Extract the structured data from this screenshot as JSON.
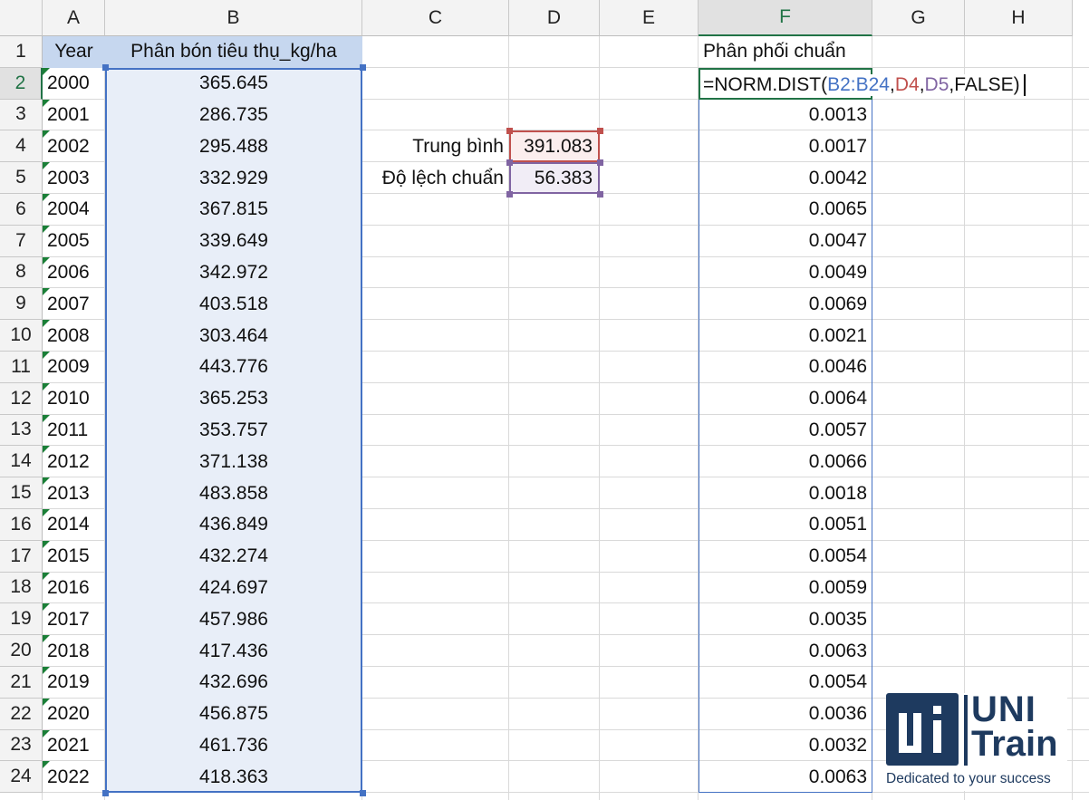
{
  "columns": [
    "A",
    "B",
    "C",
    "D",
    "E",
    "F",
    "G",
    "H"
  ],
  "active_cell": {
    "column": "F",
    "row": "2"
  },
  "header_cells": {
    "A1": "Year",
    "B1": "Phân bón tiêu thụ_kg/ha",
    "F1": "Phân phối chuẩn"
  },
  "rows": [
    {
      "n": "2",
      "year": "2000",
      "value": "365.645",
      "f": ""
    },
    {
      "n": "3",
      "year": "2001",
      "value": "286.735",
      "f": "0.0013"
    },
    {
      "n": "4",
      "year": "2002",
      "value": "295.488",
      "f": "0.0017"
    },
    {
      "n": "5",
      "year": "2003",
      "value": "332.929",
      "f": "0.0042"
    },
    {
      "n": "6",
      "year": "2004",
      "value": "367.815",
      "f": "0.0065"
    },
    {
      "n": "7",
      "year": "2005",
      "value": "339.649",
      "f": "0.0047"
    },
    {
      "n": "8",
      "year": "2006",
      "value": "342.972",
      "f": "0.0049"
    },
    {
      "n": "9",
      "year": "2007",
      "value": "403.518",
      "f": "0.0069"
    },
    {
      "n": "10",
      "year": "2008",
      "value": "303.464",
      "f": "0.0021"
    },
    {
      "n": "11",
      "year": "2009",
      "value": "443.776",
      "f": "0.0046"
    },
    {
      "n": "12",
      "year": "2010",
      "value": "365.253",
      "f": "0.0064"
    },
    {
      "n": "13",
      "year": "2011",
      "value": "353.757",
      "f": "0.0057"
    },
    {
      "n": "14",
      "year": "2012",
      "value": "371.138",
      "f": "0.0066"
    },
    {
      "n": "15",
      "year": "2013",
      "value": "483.858",
      "f": "0.0018"
    },
    {
      "n": "16",
      "year": "2014",
      "value": "436.849",
      "f": "0.0051"
    },
    {
      "n": "17",
      "year": "2015",
      "value": "432.274",
      "f": "0.0054"
    },
    {
      "n": "18",
      "year": "2016",
      "value": "424.697",
      "f": "0.0059"
    },
    {
      "n": "19",
      "year": "2017",
      "value": "457.986",
      "f": "0.0035"
    },
    {
      "n": "20",
      "year": "2018",
      "value": "417.436",
      "f": "0.0063"
    },
    {
      "n": "21",
      "year": "2019",
      "value": "432.696",
      "f": "0.0054"
    },
    {
      "n": "22",
      "year": "2020",
      "value": "456.875",
      "f": "0.0036"
    },
    {
      "n": "23",
      "year": "2021",
      "value": "461.736",
      "f": "0.0032"
    },
    {
      "n": "24",
      "year": "2022",
      "value": "418.363",
      "f": "0.0063"
    }
  ],
  "stats": {
    "mean_label": "Trung bình",
    "mean_value": "391.083",
    "sd_label": "Độ lệch chuẩn",
    "sd_value": "56.383"
  },
  "formula": {
    "prefix": "=NORM.DIST(",
    "ref_range": "B2:B24",
    "sep1": ",",
    "ref_mean": "D4",
    "sep2": ",",
    "ref_sd": "D5",
    "suffix": ",FALSE)"
  },
  "ref_colors": {
    "range": "#4472c4",
    "mean": "#c0504d",
    "sd": "#8064a2",
    "active": "#217346"
  },
  "logo": {
    "brand_line1": "UNI",
    "brand_line2": "Train",
    "tagline": "Dedicated to your success",
    "mark": "UI"
  }
}
